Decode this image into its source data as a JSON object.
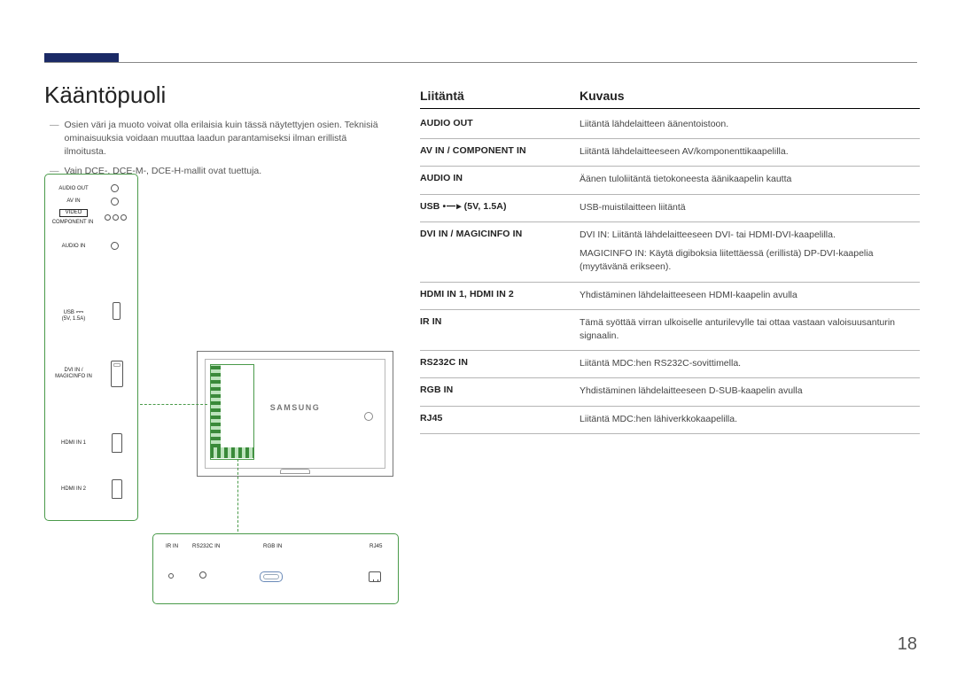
{
  "page_number": "18",
  "title": "Kääntöpuoli",
  "notes": [
    "Osien väri ja muoto voivat olla erilaisia kuin tässä näytettyjen osien. Teknisiä ominaisuuksia voidaan muuttaa laadun parantamiseksi ilman erillistä ilmoitusta.",
    "Vain DCE-, DCE-M-, DCE-H-mallit ovat tuettuja."
  ],
  "diagram": {
    "brand": "SAMSUNG",
    "vertical_labels": {
      "audio_out": "AUDIO OUT",
      "av_in": "AV IN",
      "video": "VIDEO",
      "component_in": "COMPONENT IN",
      "audio_in": "AUDIO IN",
      "usb_line1": "USB",
      "usb_line2": "(5V, 1.5A)",
      "dvi_line1": "DVI IN /",
      "dvi_line2": "MAGICINFO IN",
      "hdmi1": "HDMI IN 1",
      "hdmi2": "HDMI IN 2"
    },
    "horizontal_labels": {
      "ir_in": "IR IN",
      "rs232c": "RS232C IN",
      "rgb_in": "RGB IN",
      "rj45": "RJ45"
    }
  },
  "table": {
    "head_port": "Liitäntä",
    "head_desc": "Kuvaus",
    "rows": [
      {
        "port": "AUDIO OUT",
        "desc": [
          "Liitäntä lähdelaitteen äänentoistoon."
        ]
      },
      {
        "port": "AV IN / COMPONENT IN",
        "desc": [
          "Liitäntä lähdelaitteeseen AV/komponenttikaapelilla."
        ]
      },
      {
        "port": "AUDIO IN",
        "desc": [
          "Äänen tuloliitäntä tietokoneesta äänikaapelin kautta"
        ]
      },
      {
        "port_prefix": "USB ",
        "port_suffix": " (5V, 1.5A)",
        "usb_icon": true,
        "desc": [
          "USB-muistilaitteen liitäntä"
        ]
      },
      {
        "port": "DVI IN / MAGICINFO IN",
        "desc": [
          "DVI IN: Liitäntä lähdelaitteeseen DVI- tai HDMI-DVI-kaapelilla.",
          "MAGICINFO IN: Käytä digiboksia liitettäessä (erillistä) DP-DVI-kaapelia (myytävänä erikseen)."
        ]
      },
      {
        "port": "HDMI IN 1, HDMI IN 2",
        "desc": [
          "Yhdistäminen lähdelaitteeseen HDMI-kaapelin avulla"
        ]
      },
      {
        "port": "IR IN",
        "desc": [
          "Tämä syöttää virran ulkoiselle anturilevylle tai ottaa vastaan valoisuusanturin signaalin."
        ]
      },
      {
        "port": "RS232C IN",
        "desc": [
          "Liitäntä MDC:hen RS232C-sovittimella."
        ]
      },
      {
        "port": "RGB IN",
        "desc": [
          "Yhdistäminen lähdelaitteeseen D-SUB-kaapelin avulla"
        ]
      },
      {
        "port": "RJ45",
        "desc": [
          "Liitäntä MDC:hen lähiverkkokaapelilla."
        ]
      }
    ]
  }
}
